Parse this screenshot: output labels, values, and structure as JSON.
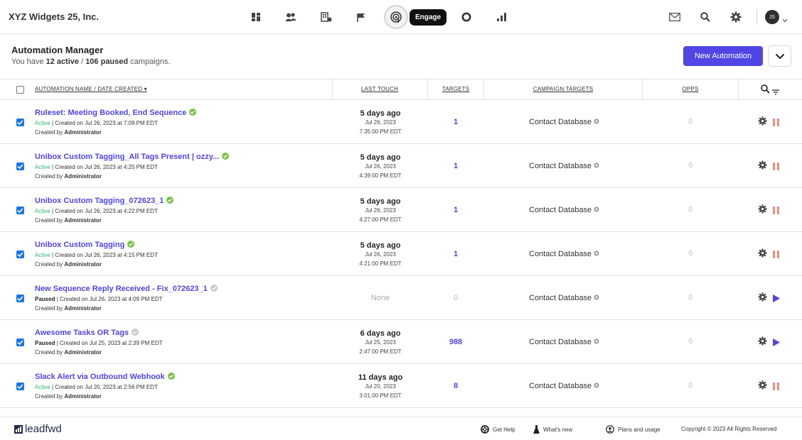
{
  "header": {
    "company": "XYZ Widgets 25, Inc.",
    "engage_label": "Engage",
    "avatar_initials": "JS"
  },
  "page": {
    "title": "Automation Manager",
    "subtitle_prefix": "You have ",
    "active_count": "12 active",
    "separator": " / ",
    "paused_count": "106 paused",
    "subtitle_suffix": " campaigns.",
    "new_button": "New Automation"
  },
  "columns": {
    "name": "AUTOMATION NAME",
    "name_sep": " / ",
    "date": "DATE CREATED",
    "sort_arrow": "▾",
    "last_touch": "LAST TOUCH",
    "targets": "TARGETS",
    "campaign_targets": "CAMPAIGN TARGETS",
    "opps": "OPPS"
  },
  "rows": [
    {
      "name": "Ruleset: Meeting Booked, End Sequence",
      "status": "Active",
      "created": " | Created on Jul 26, 2023 at 7:09 PM EDT",
      "by_prefix": "Created by ",
      "by": "Administrator",
      "lt_ago": "5 days ago",
      "lt_date": "Jul 26, 2023",
      "lt_time": "7:35:00 PM EDT",
      "targets": "1",
      "campaign_target": "Contact Database",
      "opps": "0",
      "action": "pause"
    },
    {
      "name": "Unibox Custom Tagging_All Tags Present | ozzy...",
      "status": "Active",
      "created": " | Created on Jul 26, 2023 at 4:25 PM EDT",
      "by_prefix": "Created by ",
      "by": "Administrator",
      "lt_ago": "5 days ago",
      "lt_date": "Jul 26, 2023",
      "lt_time": "4:39:00 PM EDT",
      "targets": "1",
      "campaign_target": "Contact Database",
      "opps": "0",
      "action": "pause"
    },
    {
      "name": "Unibox Custom Tagging_072623_1",
      "status": "Active",
      "created": " | Created on Jul 26, 2023 at 4:22 PM EDT",
      "by_prefix": "Created by ",
      "by": "Administrator",
      "lt_ago": "5 days ago",
      "lt_date": "Jul 26, 2023",
      "lt_time": "4:27:00 PM EDT",
      "targets": "1",
      "campaign_target": "Contact Database",
      "opps": "0",
      "action": "pause"
    },
    {
      "name": "Unibox Custom Tagging",
      "status": "Active",
      "created": " | Created on Jul 26, 2023 at 4:15 PM EDT",
      "by_prefix": "Created by ",
      "by": "Administrator",
      "lt_ago": "5 days ago",
      "lt_date": "Jul 26, 2023",
      "lt_time": "4:21:00 PM EDT",
      "targets": "1",
      "campaign_target": "Contact Database",
      "opps": "0",
      "action": "pause"
    },
    {
      "name": "New Sequence Reply Received - Fix_072623_1",
      "status": "Paused",
      "created": " | Created on Jul 26, 2023 at 4:09 PM EDT",
      "by_prefix": "Created by ",
      "by": "Administrator",
      "lt_none": "None",
      "targets": "0",
      "campaign_target": "Contact Database",
      "opps": "0",
      "action": "play"
    },
    {
      "name": "Awesome Tasks OR Tags",
      "status": "Paused",
      "created": " | Created on Jul 25, 2023 at 2:39 PM EDT",
      "by_prefix": "Created by ",
      "by": "Administrator",
      "lt_ago": "6 days ago",
      "lt_date": "Jul 25, 2023",
      "lt_time": "2:47:00 PM EDT",
      "targets": "988",
      "campaign_target": "Contact Database",
      "opps": "0",
      "action": "play"
    },
    {
      "name": "Slack Alert via Outbound Webhook",
      "status": "Active",
      "created": " | Created on Jul 20, 2023 at 2:56 PM EDT",
      "by_prefix": "Created by ",
      "by": "Administrator",
      "lt_ago": "11 days ago",
      "lt_date": "Jul 20, 2023",
      "lt_time": "3:01:00 PM EDT",
      "targets": "8",
      "campaign_target": "Contact Database",
      "opps": "0",
      "action": "pause"
    }
  ],
  "footer": {
    "logo": "leadfwd",
    "help": "Get Help",
    "whats_new": "What's new",
    "plans": "Plans and usage",
    "copyright": "Copyright © 2023 All Rights Reserved"
  },
  "colors": {
    "accent": "#4f46e5",
    "active_status": "#2bb673",
    "pause_icon": "#f28b82",
    "checkbox": "#1a73e8"
  }
}
